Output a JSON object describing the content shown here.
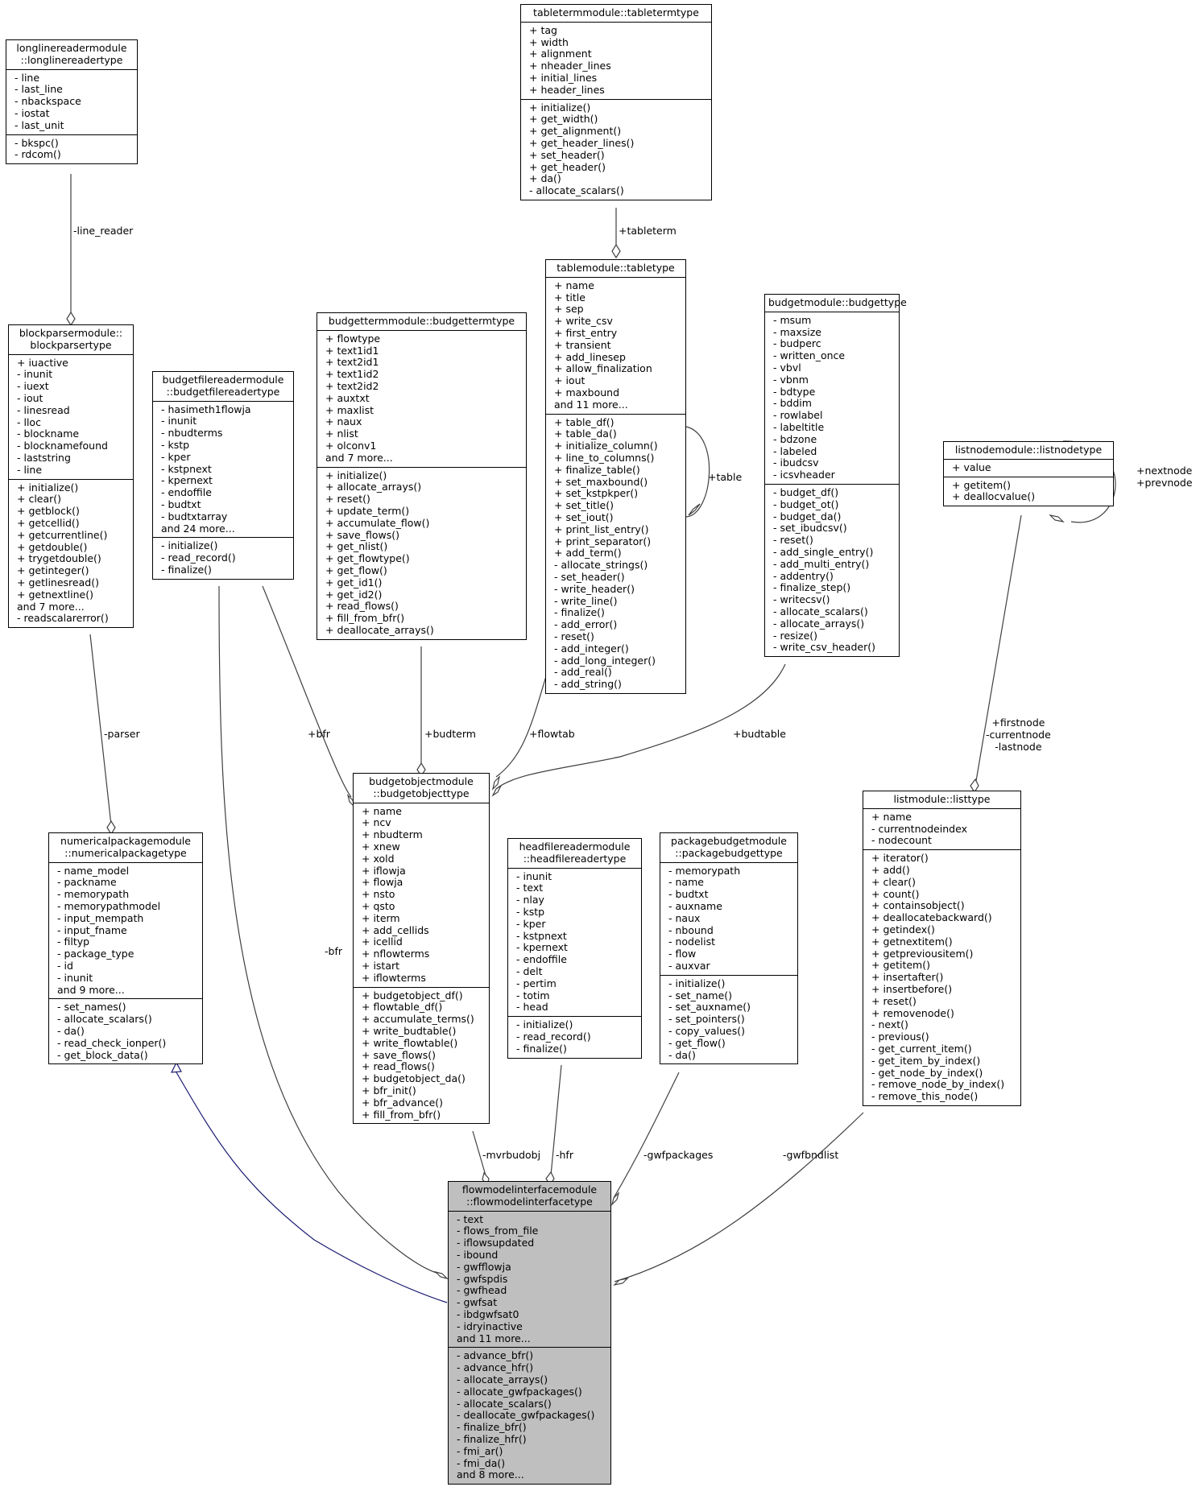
{
  "diagram": {
    "type": "doxygen-collaboration-graph",
    "focus_class": "flowmodelinterfacemodule::flowmodelinterfacetype",
    "colors": {
      "edge": "#404040",
      "inheritance_edge": "#191970",
      "focus_fill": "#bfbfbf",
      "node_fill": "#ffffff"
    }
  },
  "nodes": {
    "longlinereader": {
      "title": "longlinereadermodule\n::longlinereadertype",
      "attributes": [
        "- line",
        "- last_line",
        "- nbackspace",
        "- iostat",
        "- last_unit"
      ],
      "methods": [
        "- bkspc()",
        "- rdcom()"
      ]
    },
    "tableterm": {
      "title": "tabletermmodule::tabletermtype",
      "attributes": [
        "+ tag",
        "+ width",
        "+ alignment",
        "+ nheader_lines",
        "+ initial_lines",
        "+ header_lines"
      ],
      "methods": [
        "+ initialize()",
        "+ get_width()",
        "+ get_alignment()",
        "+ get_header_lines()",
        "+ set_header()",
        "+ get_header()",
        "+ da()",
        "- allocate_scalars()"
      ]
    },
    "blockparser": {
      "title": "blockparsermodule::\nblockparsertype",
      "attributes": [
        "+ iuactive",
        "- inunit",
        "- iuext",
        "- iout",
        "- linesread",
        "- lloc",
        "- blockname",
        "- blocknamefound",
        "- laststring",
        "- line"
      ],
      "methods": [
        "+ initialize()",
        "+ clear()",
        "+ getblock()",
        "+ getcellid()",
        "+ getcurrentline()",
        "+ getdouble()",
        "+ trygetdouble()",
        "+ getinteger()",
        "+ getlinesread()",
        "+ getnextline()",
        "and 7 more...",
        "- readscalarerror()"
      ]
    },
    "budgetfilereader": {
      "title": "budgetfilereadermodule\n::budgetfilereadertype",
      "attributes": [
        "- hasimeth1flowja",
        "- inunit",
        "- nbudterms",
        "- kstp",
        "- kper",
        "- kstpnext",
        "- kpernext",
        "- endoffile",
        "- budtxt",
        "- budtxtarray",
        "and 24 more..."
      ],
      "methods": [
        "- initialize()",
        "- read_record()",
        "- finalize()"
      ]
    },
    "budgetterm": {
      "title": "budgettermmodule::budgettermtype",
      "attributes": [
        "+ flowtype",
        "+ text1id1",
        "+ text2id1",
        "+ text1id2",
        "+ text2id2",
        "+ auxtxt",
        "+ maxlist",
        "+ naux",
        "+ nlist",
        "+ olconv1",
        "and 7 more..."
      ],
      "methods": [
        "+ initialize()",
        "+ allocate_arrays()",
        "+ reset()",
        "+ update_term()",
        "+ accumulate_flow()",
        "+ save_flows()",
        "+ get_nlist()",
        "+ get_flowtype()",
        "+ get_flow()",
        "+ get_id1()",
        "+ get_id2()",
        "+ read_flows()",
        "+ fill_from_bfr()",
        "+ deallocate_arrays()"
      ]
    },
    "table": {
      "title": "tablemodule::tabletype",
      "attributes": [
        "+ name",
        "+ title",
        "+ sep",
        "+ write_csv",
        "+ first_entry",
        "+ transient",
        "+ add_linesep",
        "+ allow_finalization",
        "+ iout",
        "+ maxbound",
        "and 11 more..."
      ],
      "methods": [
        "+ table_df()",
        "+ table_da()",
        "+ initialize_column()",
        "+ line_to_columns()",
        "+ finalize_table()",
        "+ set_maxbound()",
        "+ set_kstpkper()",
        "+ set_title()",
        "+ set_iout()",
        "+ print_list_entry()",
        "+ print_separator()",
        "+ add_term()",
        "- allocate_strings()",
        "- set_header()",
        "- write_header()",
        "- write_line()",
        "- finalize()",
        "- add_error()",
        "- reset()",
        "- add_integer()",
        "- add_long_integer()",
        "- add_real()",
        "- add_string()"
      ]
    },
    "budget": {
      "title": "budgetmodule::budgettype",
      "attributes": [
        "- msum",
        "- maxsize",
        "- budperc",
        "- written_once",
        "- vbvl",
        "- vbnm",
        "- bdtype",
        "- bddim",
        "- rowlabel",
        "- labeltitle",
        "- bdzone",
        "- labeled",
        "- ibudcsv",
        "- icsvheader"
      ],
      "methods": [
        "- budget_df()",
        "- budget_ot()",
        "- budget_da()",
        "- set_ibudcsv()",
        "- reset()",
        "- add_single_entry()",
        "- add_multi_entry()",
        "- addentry()",
        "- finalize_step()",
        "- writecsv()",
        "- allocate_scalars()",
        "- allocate_arrays()",
        "- resize()",
        "- write_csv_header()"
      ]
    },
    "listnode": {
      "title": "listnodemodule::listnodetype",
      "attributes": [
        "+ value"
      ],
      "methods": [
        "+ getitem()",
        "+ deallocvalue()"
      ]
    },
    "numericalpackage": {
      "title": "numericalpackagemodule\n::numericalpackagetype",
      "attributes": [
        "- name_model",
        "- packname",
        "- memorypath",
        "- memorypathmodel",
        "- input_mempath",
        "- input_fname",
        "- filtyp",
        "- package_type",
        "- id",
        "- inunit",
        "and 9 more..."
      ],
      "methods": [
        "- set_names()",
        "- allocate_scalars()",
        "- da()",
        "- read_check_ionper()",
        "- get_block_data()"
      ]
    },
    "budgetobject": {
      "title": "budgetobjectmodule\n::budgetobjecttype",
      "attributes": [
        "+ name",
        "+ ncv",
        "+ nbudterm",
        "+ xnew",
        "+ xold",
        "+ iflowja",
        "+ flowja",
        "+ nsto",
        "+ qsto",
        "+ iterm",
        "+ add_cellids",
        "+ icellid",
        "+ nflowterms",
        "+ istart",
        "+ iflowterms"
      ],
      "methods": [
        "+ budgetobject_df()",
        "+ flowtable_df()",
        "+ accumulate_terms()",
        "+ write_budtable()",
        "+ write_flowtable()",
        "+ save_flows()",
        "+ read_flows()",
        "+ budgetobject_da()",
        "+ bfr_init()",
        "+ bfr_advance()",
        "+ fill_from_bfr()"
      ]
    },
    "headfilereader": {
      "title": "headfilereadermodule\n::headfilereadertype",
      "attributes": [
        "- inunit",
        "- text",
        "- nlay",
        "- kstp",
        "- kper",
        "- kstpnext",
        "- kpernext",
        "- endoffile",
        "- delt",
        "- pertim",
        "- totim",
        "- head"
      ],
      "methods": [
        "- initialize()",
        "- read_record()",
        "- finalize()"
      ]
    },
    "packagebudget": {
      "title": "packagebudgetmodule\n::packagebudgettype",
      "attributes": [
        "- memorypath",
        "- name",
        "- budtxt",
        "- auxname",
        "- naux",
        "- nbound",
        "- nodelist",
        "- flow",
        "- auxvar"
      ],
      "methods": [
        "- initialize()",
        "- set_name()",
        "- set_auxname()",
        "- set_pointers()",
        "- copy_values()",
        "- get_flow()",
        "- da()"
      ]
    },
    "list": {
      "title": "listmodule::listtype",
      "attributes": [
        "+ name",
        "- currentnodeindex",
        "- nodecount"
      ],
      "methods": [
        "+ iterator()",
        "+ add()",
        "+ clear()",
        "+ count()",
        "+ containsobject()",
        "+ deallocatebackward()",
        "+ getindex()",
        "+ getnextitem()",
        "+ getpreviousitem()",
        "+ getitem()",
        "+ insertafter()",
        "+ insertbefore()",
        "+ reset()",
        "+ removenode()",
        "- next()",
        "- previous()",
        "- get_current_item()",
        "- get_item_by_index()",
        "- get_node_by_index()",
        "- remove_node_by_index()",
        "- remove_this_node()"
      ]
    },
    "flowmodelinterface": {
      "title": "flowmodelinterfacemodule\n::flowmodelinterfacetype",
      "attributes": [
        "- text",
        "- flows_from_file",
        "- iflowsupdated",
        "- ibound",
        "- gwfflowja",
        "- gwfspdis",
        "- gwfhead",
        "- gwfsat",
        "- ibdgwfsat0",
        "- idryinactive",
        "and 11 more..."
      ],
      "methods": [
        "- advance_bfr()",
        "- advance_hfr()",
        "- allocate_arrays()",
        "- allocate_gwfpackages()",
        "- allocate_scalars()",
        "- deallocate_gwfpackages()",
        "- finalize_bfr()",
        "- finalize_hfr()",
        "- fmi_ar()",
        "- fmi_da()",
        "and 8 more..."
      ]
    }
  },
  "edges": [
    {
      "from": "longlinereader",
      "to": "blockparser",
      "kind": "composition",
      "label": "-line_reader"
    },
    {
      "from": "tableterm",
      "to": "table",
      "kind": "composition",
      "label": "+tableterm"
    },
    {
      "from": "table",
      "to": "table",
      "kind": "composition",
      "label": "+table"
    },
    {
      "from": "listnode",
      "to": "listnode",
      "kind": "composition",
      "label": "+nextnode\n+prevnode"
    },
    {
      "from": "blockparser",
      "to": "numericalpackage",
      "kind": "composition",
      "label": "-parser"
    },
    {
      "from": "budgetfilereader",
      "to": "budgetobject",
      "kind": "composition",
      "label": "+bfr"
    },
    {
      "from": "budgetterm",
      "to": "budgetobject",
      "kind": "composition",
      "label": "+budterm"
    },
    {
      "from": "table",
      "to": "budgetobject",
      "kind": "composition",
      "label": "+flowtab"
    },
    {
      "from": "budget",
      "to": "budgetobject",
      "kind": "composition",
      "label": "+budtable"
    },
    {
      "from": "listnode",
      "to": "list",
      "kind": "composition",
      "label": "+firstnode\n-currentnode\n-lastnode"
    },
    {
      "from": "numericalpackage",
      "to": "flowmodelinterface",
      "kind": "inheritance",
      "label": ""
    },
    {
      "from": "budgetfilereader",
      "to": "flowmodelinterface",
      "kind": "composition",
      "label": "-bfr"
    },
    {
      "from": "budgetobject",
      "to": "flowmodelinterface",
      "kind": "composition",
      "label": "-mvrbudobj"
    },
    {
      "from": "headfilereader",
      "to": "flowmodelinterface",
      "kind": "composition",
      "label": "-hfr"
    },
    {
      "from": "packagebudget",
      "to": "flowmodelinterface",
      "kind": "composition",
      "label": "-gwfpackages"
    },
    {
      "from": "list",
      "to": "flowmodelinterface",
      "kind": "composition",
      "label": "-gwfbndlist"
    }
  ]
}
